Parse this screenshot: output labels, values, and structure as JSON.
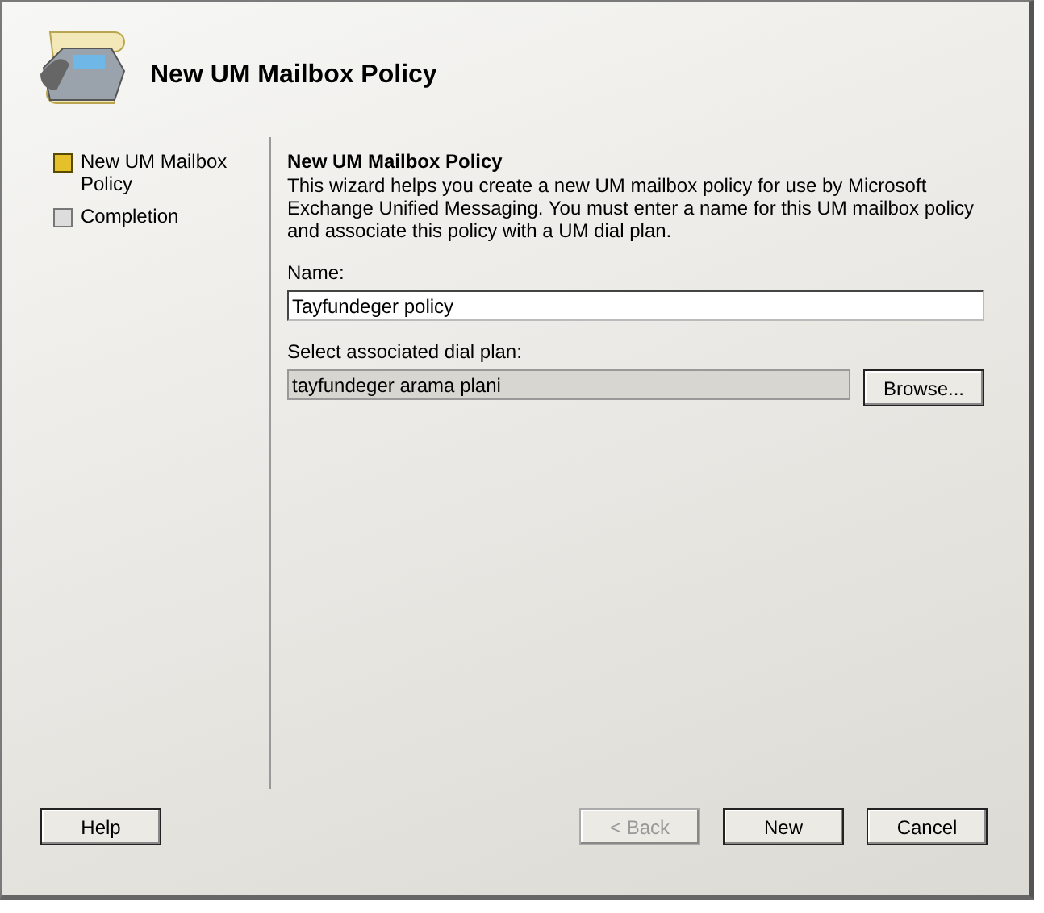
{
  "window": {
    "title": "New UM Mailbox Policy"
  },
  "steps": [
    {
      "label": "New UM Mailbox Policy",
      "selected": true
    },
    {
      "label": "Completion",
      "selected": false
    }
  ],
  "page": {
    "heading": "New UM Mailbox Policy",
    "description": "This wizard helps you create a new UM mailbox policy for use by Microsoft Exchange Unified Messaging. You must enter a name for this UM mailbox policy and associate this policy with a UM dial plan.",
    "fields": [
      {
        "label": "Name:",
        "value": "Tayfundeger policy",
        "readonly": false
      },
      {
        "label": "Select associated dial plan:",
        "value": "tayfundeger arama plani",
        "readonly": true,
        "button": "Browse..."
      }
    ]
  },
  "buttons": [
    {
      "label": "Help",
      "disabled": false,
      "kind": "left"
    },
    {
      "label": "< Back",
      "disabled": true,
      "kind": "right"
    },
    {
      "label": "New",
      "disabled": false,
      "kind": "right"
    },
    {
      "label": "Cancel",
      "disabled": false,
      "kind": "right"
    }
  ]
}
